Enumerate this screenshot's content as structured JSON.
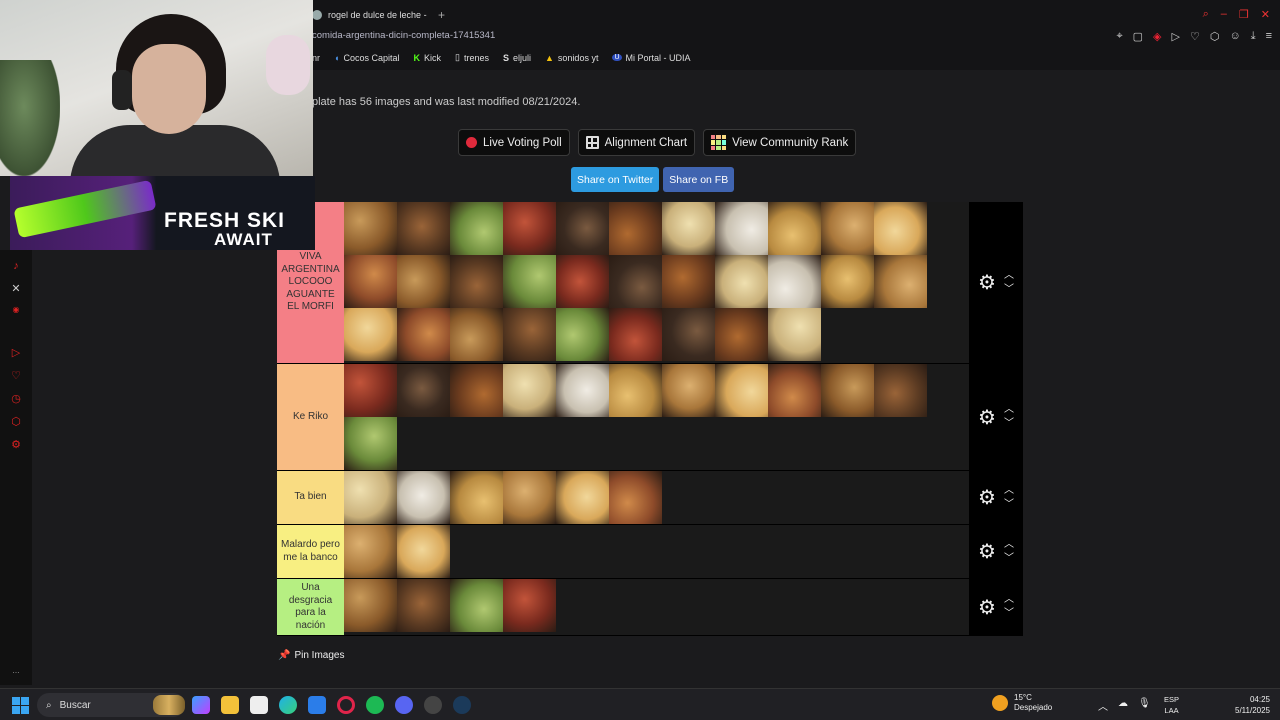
{
  "browser": {
    "tab_title": "rogel de dulce de leche -",
    "new_tab_icon": "+",
    "url": "comida-argentina-dicin-completa-17415341",
    "bookmarks": [
      {
        "icon": "dot",
        "label": "nr"
      },
      {
        "icon": "C",
        "label": "Cocos Capital"
      },
      {
        "icon": "K",
        "label": "Kick"
      },
      {
        "icon": "doc",
        "label": "trenes"
      },
      {
        "icon": "S",
        "label": "eljuli"
      },
      {
        "icon": "triangle",
        "label": "sonidos yt"
      },
      {
        "icon": "U",
        "label": "Mi Portal - UDIA"
      }
    ]
  },
  "overlay": {
    "banner_line1": "FRESH SKI",
    "banner_line2": "AWAIT"
  },
  "page": {
    "subtitle": "plate has 56 images and was last modified 08/21/2024.",
    "buttons": {
      "live_poll": "Live Voting Poll",
      "alignment": "Alignment Chart",
      "community": "View Community Rank"
    },
    "share_twitter": "Share on Twitter",
    "share_fb": "Share on FB",
    "pin_images": "Pin Images"
  },
  "colors": {
    "tier1": "#f47f86",
    "tier2": "#f8bc84",
    "tier3": "#f9dc82",
    "tier4": "#f8ef82",
    "tier5": "#b6ef82"
  },
  "tiers": [
    {
      "label": "VIVA ARGENTINA LOCOOO AGUANTE EL MORFI",
      "count": 31
    },
    {
      "label": "Ke Riko",
      "count": 12
    },
    {
      "label": "Ta bien",
      "count": 6
    },
    {
      "label": "Malardo pero me la banco",
      "count": 2
    },
    {
      "label": "Una desgracia para la nación",
      "count": 4
    }
  ],
  "taskbar": {
    "search": "Buscar",
    "weather_temp": "15°C",
    "weather_text": "Despejado",
    "lang_top": "ESP",
    "lang_bottom": "LAA",
    "time": "04:25",
    "date": "5/11/2025"
  }
}
